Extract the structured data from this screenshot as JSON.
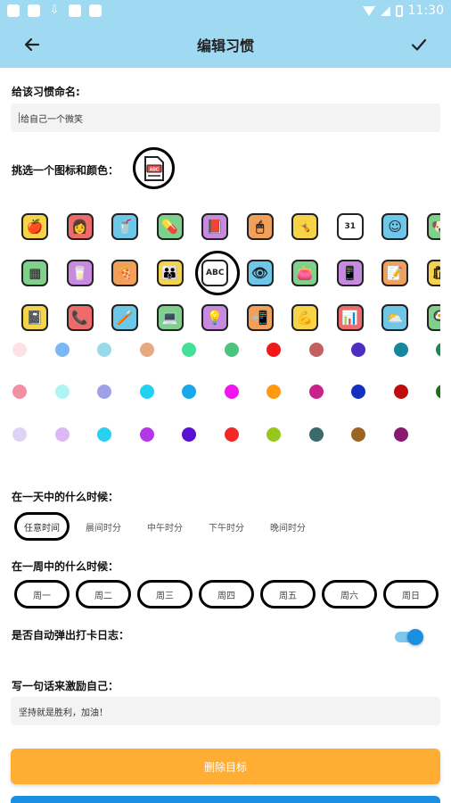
{
  "status_bar": {
    "time": "11:30"
  },
  "app_bar": {
    "title": "编辑习惯"
  },
  "name_section": {
    "label": "给该习惯命名:",
    "value": "给自己一个微笑"
  },
  "icon_section": {
    "label": "挑选一个图标和颜色：",
    "selected_icon": "abc-document-icon",
    "rows": [
      [
        "apple-icon",
        "mother-child-icon",
        "drink-cup-icon",
        "medicine-bottle-icon",
        "book-icon",
        "computer-mouse-icon",
        "exercise-people-icon",
        "calendar-icon",
        "smile-face-icon",
        "dog-icon"
      ],
      [
        "photo-card-icon",
        "water-glass-icon",
        "pizza-icon",
        "family-icon",
        "abc-document-icon",
        "eye-icon",
        "wallet-icon",
        "phone-chat-icon",
        "notes-icon",
        "shopping-icon",
        "guitar-icon"
      ],
      [
        "notebook-icon",
        "phone-call-icon",
        "toothbrush-icon",
        "workspace-icon",
        "lightbulb-icon",
        "tablet-icon",
        "strong-man-icon",
        "presentation-icon",
        "weather-icon",
        "cooking-icon"
      ]
    ],
    "selected_row": 1,
    "selected_col": 4
  },
  "colors": [
    [
      "#fde1e6",
      "#7ab8f5",
      "#98dbe8",
      "#e8a882",
      "#43e09a",
      "#4cc47d",
      "#f01818",
      "#c36060",
      "#4d2ec0",
      "#16869e",
      "#188a50"
    ],
    [
      "#f58fa4",
      "#aef5f2",
      "#9fa0e8",
      "#22d2f0",
      "#16a8e8",
      "#f014f0",
      "#ff9a10",
      "#c8228c",
      "#1430c0",
      "#bf0d0d",
      "#1d6e1d"
    ],
    [
      "#ddd4f5",
      "#deb8f5",
      "#2ad0f0",
      "#b436e8",
      "#5a10d2",
      "#f52626",
      "#96c81c",
      "#3a6a6a",
      "#9a6422",
      "#8a1a70"
    ]
  ],
  "time_of_day": {
    "label": "在一天中的什么时候：",
    "options": [
      "任意时间",
      "晨间时分",
      "中午时分",
      "下午时分",
      "晚间时分"
    ],
    "selected": 0
  },
  "day_of_week": {
    "label": "在一周中的什么时候：",
    "days": [
      "周一",
      "周二",
      "周三",
      "周四",
      "周五",
      "周六",
      "周日"
    ]
  },
  "auto_popup": {
    "label": "是否自动弹出打卡日志：",
    "enabled": true
  },
  "motto": {
    "label": "写一句话来激励自己：",
    "value": "坚持就是胜利，加油！"
  },
  "buttons": {
    "delete": "删除目标"
  }
}
